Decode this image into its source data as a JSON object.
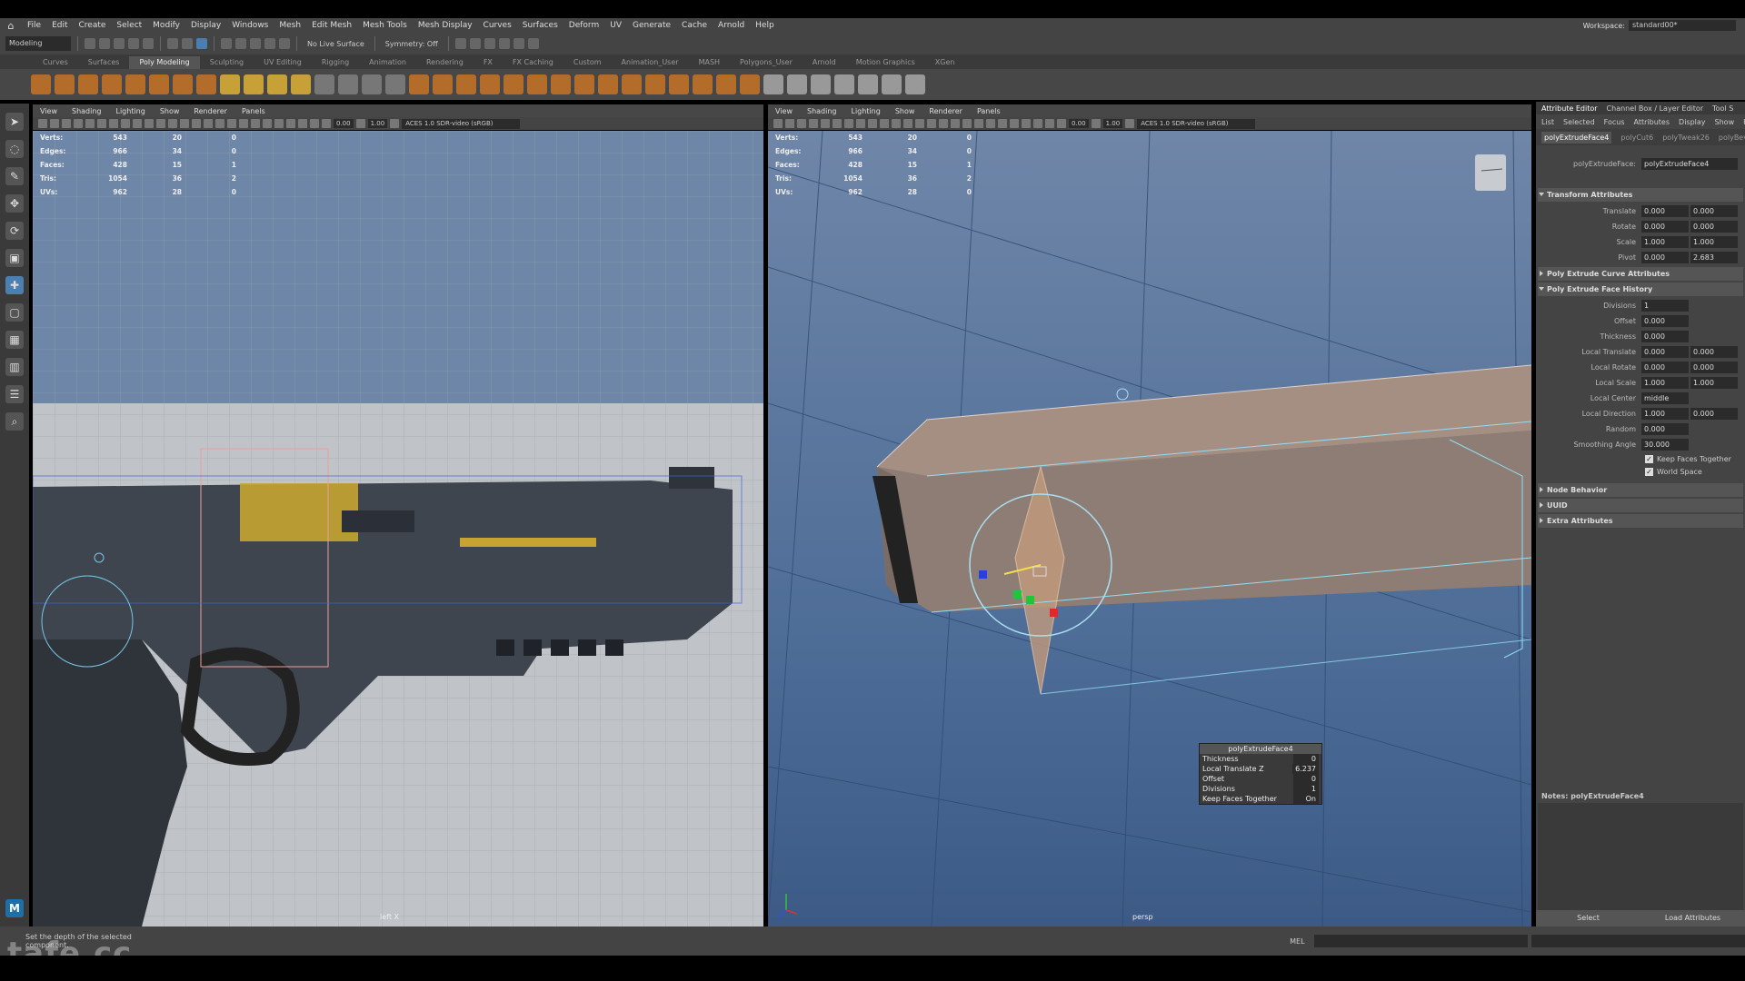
{
  "menubar": {
    "items": [
      "File",
      "Edit",
      "Create",
      "Select",
      "Modify",
      "Display",
      "Windows",
      "Mesh",
      "Edit Mesh",
      "Mesh Tools",
      "Mesh Display",
      "Curves",
      "Surfaces",
      "Deform",
      "UV",
      "Generate",
      "Cache",
      "Arnold",
      "Help"
    ],
    "workspace_label": "Workspace:",
    "workspace_value": "standard00*"
  },
  "statusline": {
    "mode": "Modeling",
    "live_surface": "No Live Surface",
    "symmetry": "Symmetry: Off"
  },
  "shelf_tabs": [
    "Curves",
    "Surfaces",
    "Poly Modeling",
    "Sculpting",
    "UV Editing",
    "Rigging",
    "Animation",
    "Rendering",
    "FX",
    "FX Caching",
    "Custom",
    "Animation_User",
    "MASH",
    "Polygons_User",
    "Arnold",
    "Motion Graphics",
    "XGen"
  ],
  "shelf_active_tab": "Poly Modeling",
  "panel_menu": [
    "View",
    "Shading",
    "Lighting",
    "Show",
    "Renderer",
    "Panels"
  ],
  "viewport_controls": {
    "exposure": "0.00",
    "gamma": "1.00",
    "color_space": "ACES 1.0 SDR-video (sRGB)"
  },
  "hud": {
    "rows": [
      {
        "label": "Verts:",
        "a": "543",
        "b": "20",
        "c": "0"
      },
      {
        "label": "Edges:",
        "a": "966",
        "b": "34",
        "c": "0"
      },
      {
        "label": "Faces:",
        "a": "428",
        "b": "15",
        "c": "1"
      },
      {
        "label": "Tris:",
        "a": "1054",
        "b": "36",
        "c": "2"
      },
      {
        "label": "UVs:",
        "a": "962",
        "b": "28",
        "c": "0"
      }
    ]
  },
  "viewports": {
    "left_label": "left X",
    "right_label": "persp"
  },
  "popup": {
    "title": "polyExtrudeFace4",
    "rows": [
      {
        "label": "Thickness",
        "value": "0"
      },
      {
        "label": "Local Translate Z",
        "value": "6.237"
      },
      {
        "label": "Offset",
        "value": "0"
      },
      {
        "label": "Divisions",
        "value": "1"
      },
      {
        "label": "Keep Faces Together",
        "value": "On"
      }
    ]
  },
  "attribute_editor": {
    "tabs": [
      "Attribute Editor",
      "Channel Box / Layer Editor",
      "Tool S"
    ],
    "menu": [
      "List",
      "Selected",
      "Focus",
      "Attributes",
      "Display",
      "Show",
      "He"
    ],
    "node_tabs": [
      "polyExtrudeFace4",
      "polyCut6",
      "polyTweak26",
      "polyBev"
    ],
    "node_label": "polyExtrudeFace:",
    "node_value": "polyExtrudeFace4",
    "transform_section": "Transform Attributes",
    "transform_rows": [
      {
        "label": "Translate",
        "a": "0.000",
        "b": "0.000"
      },
      {
        "label": "Rotate",
        "a": "0.000",
        "b": "0.000"
      },
      {
        "label": "Scale",
        "a": "1.000",
        "b": "1.000"
      },
      {
        "label": "Pivot",
        "a": "0.000",
        "b": "2.683"
      }
    ],
    "curve_section": "Poly Extrude Curve Attributes",
    "history_section": "Poly Extrude Face History",
    "history_rows": [
      {
        "label": "Divisions",
        "a": "1",
        "b": ""
      },
      {
        "label": "Offset",
        "a": "0.000",
        "b": ""
      },
      {
        "label": "Thickness",
        "a": "0.000",
        "b": ""
      },
      {
        "label": "Local Translate",
        "a": "0.000",
        "b": "0.000"
      },
      {
        "label": "Local Rotate",
        "a": "0.000",
        "b": "0.000"
      },
      {
        "label": "Local Scale",
        "a": "1.000",
        "b": "1.000"
      },
      {
        "label": "Local Center",
        "a": "middle",
        "b": ""
      },
      {
        "label": "Local Direction",
        "a": "1.000",
        "b": "0.000"
      },
      {
        "label": "Random",
        "a": "0.000",
        "b": ""
      },
      {
        "label": "Smoothing Angle",
        "a": "30.000",
        "b": ""
      }
    ],
    "keep_faces": "Keep Faces Together",
    "world_space": "World Space",
    "node_behavior": "Node Behavior",
    "uuid": "UUID",
    "extra": "Extra Attributes",
    "notes": "Notes: polyExtrudeFace4",
    "select_btn": "Select",
    "load_btn": "Load Attributes"
  },
  "helpline": {
    "message": "Set the depth of the selected component.",
    "mel": "MEL"
  },
  "watermark": "tafe.cc"
}
